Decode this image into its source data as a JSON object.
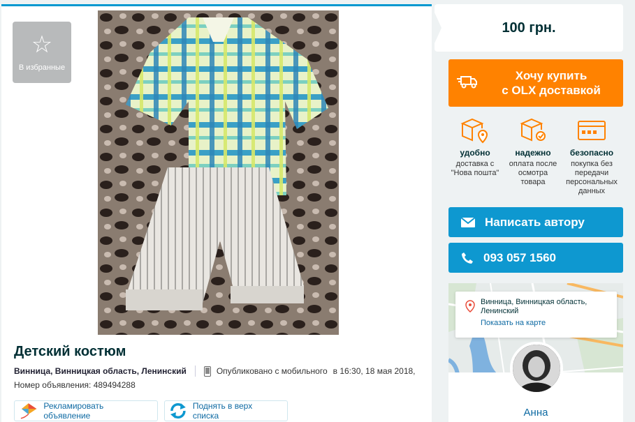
{
  "favorites": {
    "label": "В избранные",
    "icon": "star-icon"
  },
  "listing": {
    "title": "Детский костюм",
    "location": "Винница, Винницкая область, Ленинский",
    "published_via": "Опубликовано с мобильного",
    "published_time": "в 16:30, 18 мая 2018,",
    "ad_number": "Номер объявления: 489494288"
  },
  "actions": {
    "promote_label": "Рекламировать объявление",
    "bump_label": "Поднять в верх списка"
  },
  "price": {
    "value": "100 грн."
  },
  "delivery": {
    "buy_line1": "Хочу купить",
    "buy_line2": "с OLX доставкой",
    "features": [
      {
        "title": "удобно",
        "desc": "доставка с \"Нова пошта\"",
        "icon": "box-pin-icon"
      },
      {
        "title": "надежно",
        "desc": "оплата после осмотра товара",
        "icon": "box-check-icon"
      },
      {
        "title": "безопасно",
        "desc": "покупка без передачи персональных данных",
        "icon": "card-icon"
      }
    ]
  },
  "contact": {
    "message_label": "Написать автору",
    "phone_label": "093 057 1560"
  },
  "map": {
    "location": "Винница, Винницкая область, Ленинский",
    "show_on_map": "Показать на карте"
  },
  "seller": {
    "name": "Анна"
  },
  "colors": {
    "orange": "#ff8200",
    "blue": "#0e98d0",
    "link": "#0e6aa3",
    "dark": "#002f34"
  }
}
